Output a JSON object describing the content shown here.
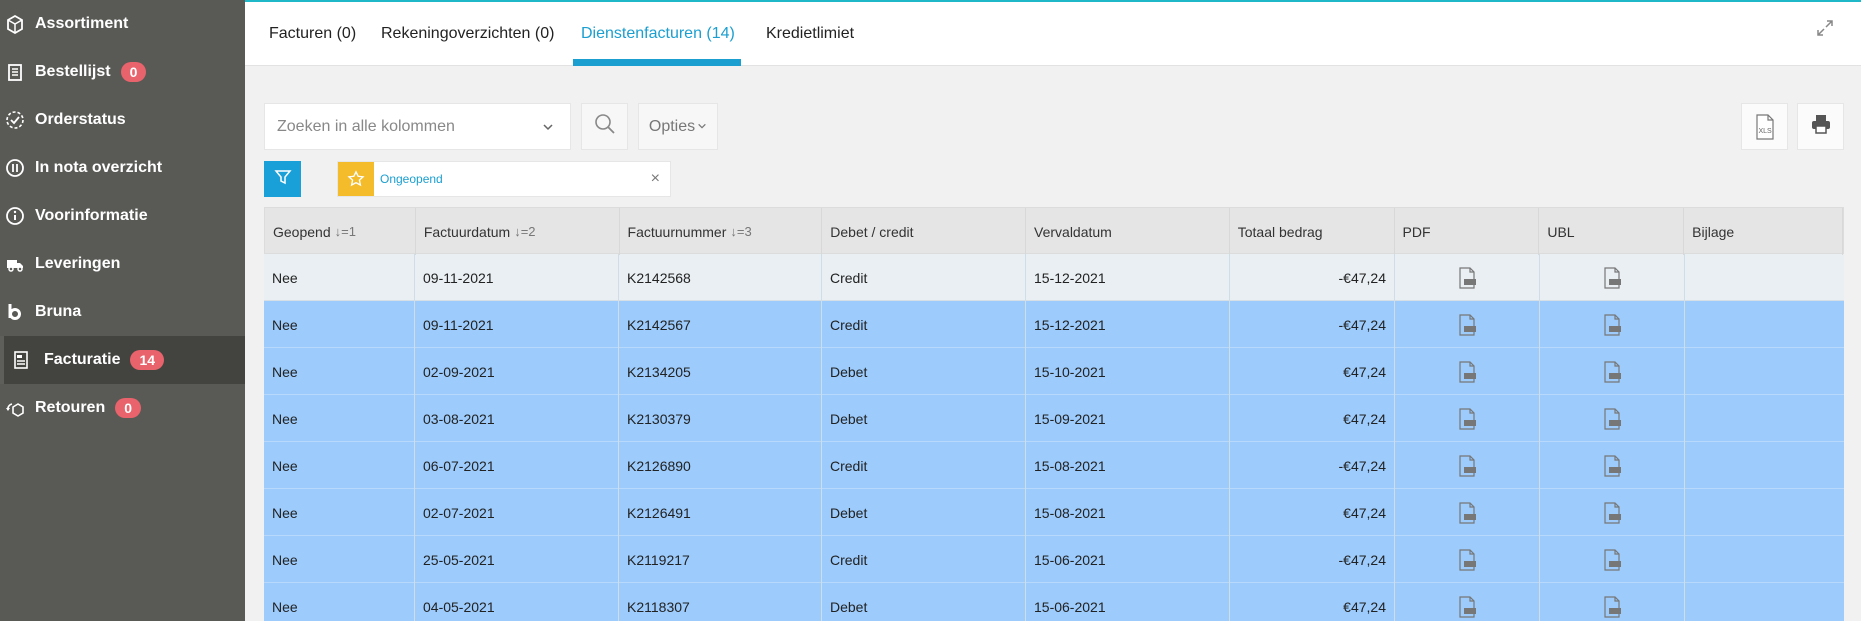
{
  "sidebar": {
    "items": [
      {
        "label": "Assortiment",
        "icon": "box-icon"
      },
      {
        "label": "Bestellijst",
        "icon": "clipboard-list-icon",
        "badge": "0"
      },
      {
        "label": "Orderstatus",
        "icon": "check-circle-icon"
      },
      {
        "label": "In nota overzicht",
        "icon": "pause-circle-icon"
      },
      {
        "label": "Voorinformatie",
        "icon": "info-circle-icon"
      },
      {
        "label": "Leveringen",
        "icon": "delivery-truck-icon"
      },
      {
        "label": "Bruna",
        "icon": "bruna-logo-icon"
      },
      {
        "label": "Facturatie",
        "icon": "invoice-icon",
        "badge": "14",
        "active": true
      },
      {
        "label": "Retouren",
        "icon": "return-box-icon",
        "badge": "0"
      }
    ]
  },
  "tabs": [
    {
      "label": "Facturen (0)"
    },
    {
      "label": "Rekeningoverzichten (0)"
    },
    {
      "label": "Dienstenfacturen (14)",
      "active": true
    },
    {
      "label": "Kredietlimiet"
    }
  ],
  "toolbar": {
    "search_placeholder": "Zoeken in alle kolommen",
    "options_label": "Opties",
    "xls_label": "XLS"
  },
  "filter_chip": {
    "label": "Ongeopend"
  },
  "table": {
    "columns": [
      {
        "label": "Geopend",
        "sort": "↓=1"
      },
      {
        "label": "Factuurdatum",
        "sort": "↓=2"
      },
      {
        "label": "Factuurnummer",
        "sort": "↓=3"
      },
      {
        "label": "Debet / credit",
        "sort": ""
      },
      {
        "label": "Vervaldatum",
        "sort": ""
      },
      {
        "label": "Totaal bedrag",
        "sort": ""
      },
      {
        "label": "PDF",
        "sort": ""
      },
      {
        "label": "UBL",
        "sort": ""
      },
      {
        "label": "Bijlage",
        "sort": ""
      }
    ],
    "rows": [
      {
        "geopend": "Nee",
        "factuurdatum": "09-11-2021",
        "factuurnummer": "K2142568",
        "debet_credit": "Credit",
        "vervaldatum": "15-12-2021",
        "totaal": "-€47,24"
      },
      {
        "geopend": "Nee",
        "factuurdatum": "09-11-2021",
        "factuurnummer": "K2142567",
        "debet_credit": "Credit",
        "vervaldatum": "15-12-2021",
        "totaal": "-€47,24"
      },
      {
        "geopend": "Nee",
        "factuurdatum": "02-09-2021",
        "factuurnummer": "K2134205",
        "debet_credit": "Debet",
        "vervaldatum": "15-10-2021",
        "totaal": "€47,24"
      },
      {
        "geopend": "Nee",
        "factuurdatum": "03-08-2021",
        "factuurnummer": "K2130379",
        "debet_credit": "Debet",
        "vervaldatum": "15-09-2021",
        "totaal": "€47,24"
      },
      {
        "geopend": "Nee",
        "factuurdatum": "06-07-2021",
        "factuurnummer": "K2126890",
        "debet_credit": "Credit",
        "vervaldatum": "15-08-2021",
        "totaal": "-€47,24"
      },
      {
        "geopend": "Nee",
        "factuurdatum": "02-07-2021",
        "factuurnummer": "K2126491",
        "debet_credit": "Debet",
        "vervaldatum": "15-08-2021",
        "totaal": "€47,24"
      },
      {
        "geopend": "Nee",
        "factuurdatum": "25-05-2021",
        "factuurnummer": "K2119217",
        "debet_credit": "Credit",
        "vervaldatum": "15-06-2021",
        "totaal": "-€47,24"
      },
      {
        "geopend": "Nee",
        "factuurdatum": "04-05-2021",
        "factuurnummer": "K2118307",
        "debet_credit": "Debet",
        "vervaldatum": "15-06-2021",
        "totaal": "€47,24"
      }
    ]
  },
  "colors": {
    "sidebar_bg": "#595955",
    "accent": "#1a9fd0",
    "badge": "#e8636c",
    "selected_row": "#9ccbfc",
    "star": "#f4bb2a"
  }
}
